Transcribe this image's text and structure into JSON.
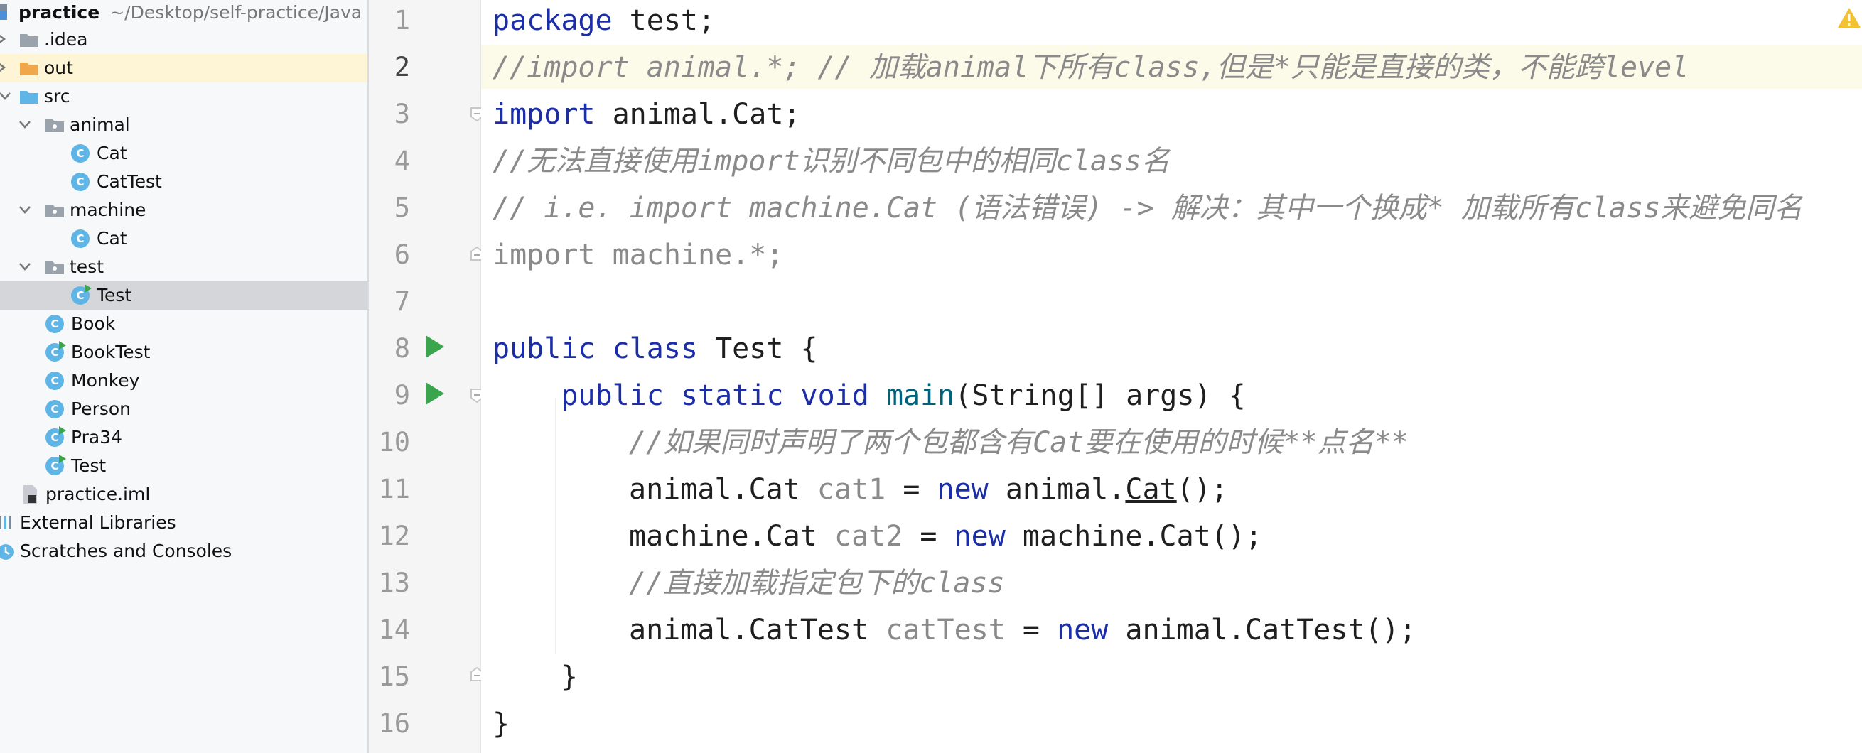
{
  "project": {
    "name": "practice",
    "path": "~/Desktop/self-practice/Java",
    "tree": [
      {
        "label": ".idea",
        "icon": "folder-icon"
      },
      {
        "label": "out",
        "icon": "folder-icon"
      },
      {
        "label": "src",
        "icon": "folder-icon"
      },
      {
        "label": "animal",
        "icon": "package-icon"
      },
      {
        "label": "Cat",
        "icon": "class-icon"
      },
      {
        "label": "CatTest",
        "icon": "class-icon"
      },
      {
        "label": "machine",
        "icon": "package-icon"
      },
      {
        "label": "Cat",
        "icon": "class-icon"
      },
      {
        "label": "test",
        "icon": "package-icon"
      },
      {
        "label": "Test",
        "icon": "runnable-class-icon"
      },
      {
        "label": "Book",
        "icon": "class-icon"
      },
      {
        "label": "BookTest",
        "icon": "runnable-class-icon"
      },
      {
        "label": "Monkey",
        "icon": "class-icon"
      },
      {
        "label": "Person",
        "icon": "class-icon"
      },
      {
        "label": "Pra34",
        "icon": "runnable-class-icon"
      },
      {
        "label": "Test",
        "icon": "runnable-class-icon"
      },
      {
        "label": "practice.iml",
        "icon": "module-file-icon"
      },
      {
        "label": "External Libraries",
        "icon": "libraries-icon"
      },
      {
        "label": "Scratches and Consoles",
        "icon": "scratches-icon"
      }
    ]
  },
  "colors": {
    "keyword": "#1b2ea8",
    "comment": "#8a8a8a",
    "method": "#00627a",
    "run": "#3aa54d",
    "class_badge": "#5fb6e6",
    "out_folder": "#f0a64a"
  },
  "editor": {
    "line_numbers": [
      "1",
      "2",
      "3",
      "4",
      "5",
      "6",
      "7",
      "8",
      "9",
      "10",
      "11",
      "12",
      "13",
      "14",
      "15",
      "16"
    ],
    "tokens": {
      "l1_kw": "package",
      "l1_rest": " test;",
      "l2": "//import animal.*; // 加载animal下所有class,但是*只能是直接的类，不能跨level",
      "l3_kw": "import",
      "l3_rest": " animal.Cat;",
      "l4": "//无法直接使用import识别不同包中的相同class名",
      "l5": "// i.e. import machine.Cat (语法错误) -> 解决：其中一个换成* 加载所有class来避免同名",
      "l6": "import machine.*;",
      "l8_kw1": "public",
      "l8_kw2": "class",
      "l8_rest": " Test {",
      "l9_kw1": "public",
      "l9_kw2": "static",
      "l9_kw3": "void",
      "l9_mth": "main",
      "l9_rest": "(String[] args) {",
      "l10": "//如果同时声明了两个包都含有Cat要在使用的时候**点名**",
      "l11_a": "animal.Cat ",
      "l11_var": "cat1",
      "l11_b": " = ",
      "l11_kw": "new",
      "l11_c": " animal.",
      "l11_ul": "Cat",
      "l11_d": "();",
      "l12_a": "machine.Cat ",
      "l12_var": "cat2",
      "l12_b": " = ",
      "l12_kw": "new",
      "l12_c": " machine.Cat();",
      "l13": "//直接加载指定包下的class",
      "l14_a": "animal.CatTest ",
      "l14_var": "catTest",
      "l14_b": " = ",
      "l14_kw": "new",
      "l14_c": " animal.CatTest();",
      "l15": "}",
      "l16": "}"
    }
  }
}
